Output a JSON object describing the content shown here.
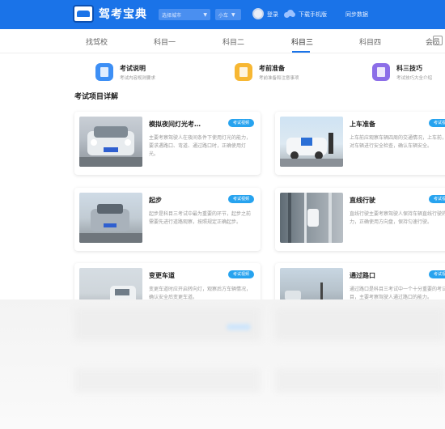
{
  "header": {
    "app_name": "驾考宝典",
    "city_select": "选择城市",
    "car_select": "小车",
    "links": [
      "登录",
      "下载手机版",
      "同步数据"
    ]
  },
  "tabs": {
    "items": [
      "找驾校",
      "科目一",
      "科目二",
      "科目三",
      "科目四",
      "会员"
    ],
    "active_index": 3
  },
  "features": [
    {
      "title": "考试说明",
      "sub": "考试内容规则要求",
      "color": "#3d8ff5",
      "icon": "doc-icon"
    },
    {
      "title": "考前准备",
      "sub": "考前准备和注意事项",
      "color": "#f7b733",
      "icon": "bag-icon"
    },
    {
      "title": "科三技巧",
      "sub": "考试技巧大全介绍",
      "color": "#8c6ee8",
      "icon": "tips-icon"
    }
  ],
  "section_title": "考试项目详解",
  "cards": [
    {
      "title": "模拟夜间灯光考…",
      "badge": "考试视频",
      "desc": "主要考察驾驶人在夜间条件下使用灯光的能力，要求遇路口、弯道、通过路口时，正确使用灯光。"
    },
    {
      "title": "上车准备",
      "badge": "考试视频",
      "desc": "上车前应观察车辆四周的交通情况，上车前，应对车辆进行安全检查，确认车辆安全。"
    },
    {
      "title": "起步",
      "badge": "考试视频",
      "desc": "起步是科目三考试中最为重要的环节，起步之前需要先进行道路观察，按照规定正确起步。"
    },
    {
      "title": "直线行驶",
      "badge": "考试视频",
      "desc": "直线行驶主要考察驾驶人保持车辆直线行驶的能力，正确使用方向盘，保持匀速行驶。"
    },
    {
      "title": "变更车道",
      "badge": "考试视频",
      "desc": "变更车道时应开启转向灯，观察后方车辆情况，确认安全后变更车道。"
    },
    {
      "title": "通过路口",
      "badge": "考试视频",
      "desc": "通过路口是科目三考试中一个十分重要的考试项目，主要考察驾驶人通过路口的能力。"
    }
  ]
}
